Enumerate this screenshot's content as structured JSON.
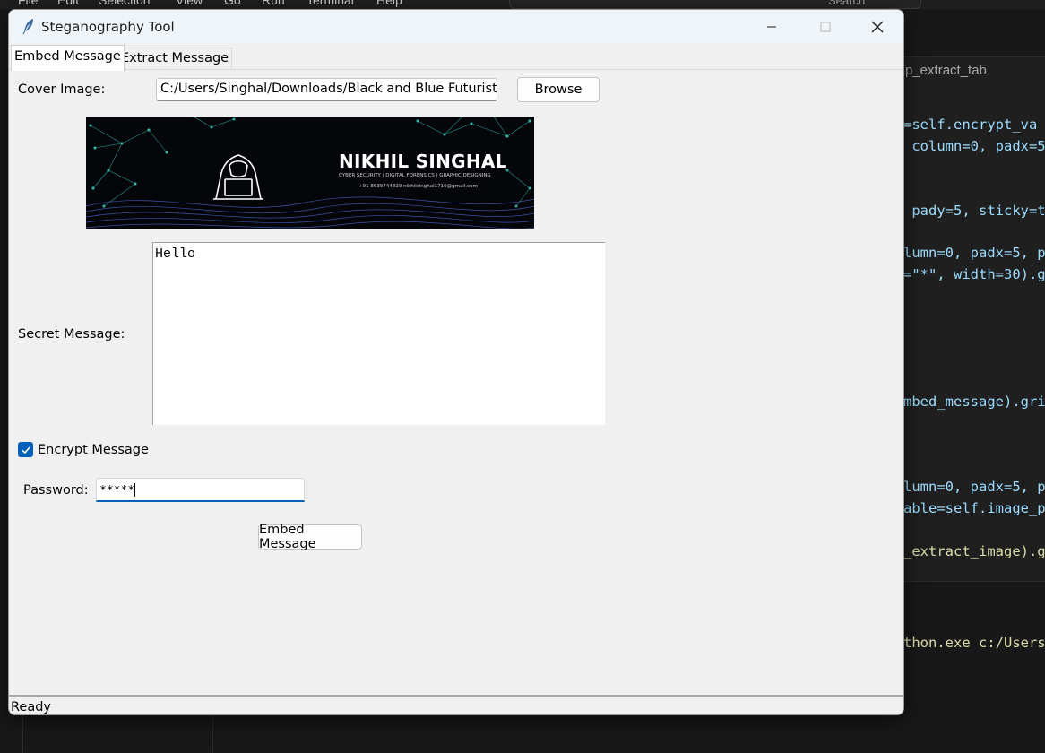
{
  "vscode": {
    "menu": [
      "File",
      "Edit",
      "Selection",
      "View",
      "Go",
      "Run",
      "Terminal",
      "Help"
    ],
    "search_placeholder": "Search",
    "breadcrumb": "p_extract_tab",
    "code_lines": [
      "=self.encrypt_va",
      " column=0, padx=5",
      " pady=5, sticky=t",
      "lumn=0, padx=5, p",
      "=\"*\", width=30).g",
      "mbed_message).gri",
      "lumn=0, padx=5, p",
      "able=self.image_p",
      "_extract_image).g",
      "thon.exe c:/Users/S"
    ]
  },
  "window": {
    "title": "Steganography Tool",
    "icon": "feather-icon",
    "controls": [
      "minimize-icon",
      "maximize-icon",
      "close-icon"
    ]
  },
  "tabs": [
    {
      "label": "Embed Message",
      "active": true
    },
    {
      "label": "Extract Message",
      "active": false
    }
  ],
  "embed": {
    "cover_label": "Cover Image:",
    "cover_path": "C:/Users/Singhal/Downloads/Black and Blue Futuristic Da",
    "browse_label": "Browse",
    "banner": {
      "name": "NIKHIL SINGHAL",
      "subtitle": "CYBER SECURITY | DIGITAL FORENSICS | GRAPHIC DESIGNING",
      "contact": "+91 8639744829   nikhilsinghal1710@gmail.com"
    },
    "secret_label": "Secret Message:",
    "secret_text": "Hello",
    "encrypt_label": "Encrypt Message",
    "encrypt_checked": true,
    "password_label": "Password:",
    "password_value": "*****",
    "embed_button": "Embed Message"
  },
  "status": "Ready",
  "colors": {
    "accent": "#005fb8",
    "window_bg": "#f0f0f0",
    "titlebar_bg": "#eff4f9"
  }
}
